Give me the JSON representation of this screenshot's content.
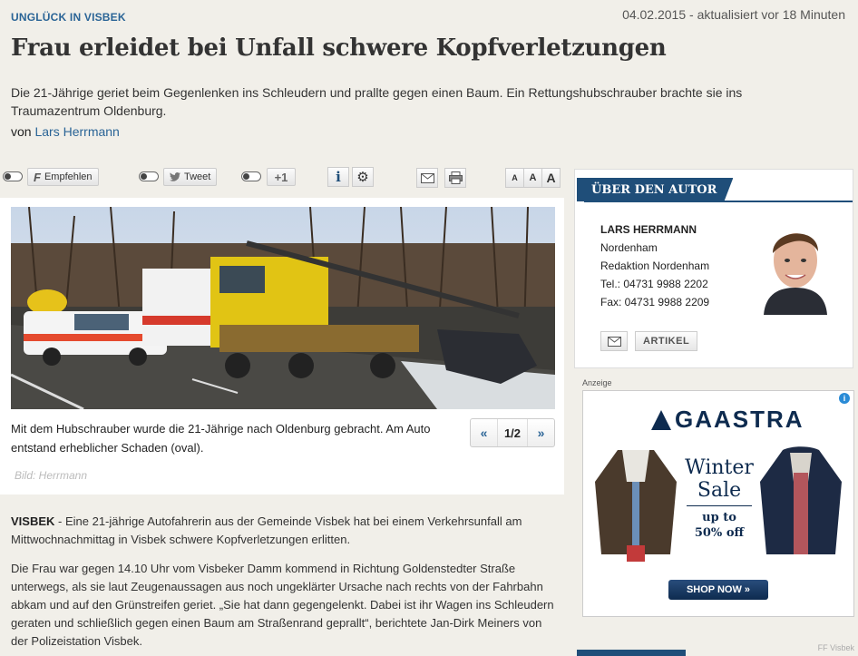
{
  "header": {
    "topline": "UNGLÜCK IN VISBEK",
    "date": "04.02.2015 - aktualisiert vor 18 Minuten",
    "headline": "Frau erleidet bei Unfall schwere Kopfverletzungen",
    "teaser": "Die 21-Jährige geriet beim Gegenlenken ins Schleudern und prallte gegen einen Baum. Ein Rettungshubschrauber brachte sie ins Traumazentrum Oldenburg.",
    "byline_prefix": "von",
    "author_link": "Lars Herrmann"
  },
  "toolbar": {
    "facebook_label": "Empfehlen",
    "facebook_glyph": "F",
    "twitter_label": "Tweet",
    "gplus_label": "+1",
    "info_glyph": "i",
    "settings_glyph": "⚙",
    "mail_glyph": "✉",
    "print_glyph": "🖶",
    "font_small": "A",
    "font_medium": "A",
    "font_large": "A"
  },
  "media": {
    "caption": "Mit dem Hubschrauber wurde die 21-Jährige nach Oldenburg gebracht. Am Auto entstand erheblicher Schaden (oval).",
    "pager_prev": "«",
    "pager_count": "1/2",
    "pager_next": "»",
    "credit": "Bild: Herrmann"
  },
  "article": {
    "dateline": "VISBEK",
    "p1": " - Eine 21-jährige Autofahrerin aus der Gemeinde Visbek hat bei einem Verkehrsunfall am Mittwochnachmittag in Visbek schwere Kopfverletzungen erlitten.",
    "p2": "Die Frau war gegen 14.10 Uhr vom Visbeker Damm kommend in Richtung Goldenstedter Straße unterwegs, als sie laut Zeugenaussagen aus noch ungeklärter Ursache nach rechts von der Fahrbahn abkam und auf den Grünstreifen geriet. „Sie hat dann gegengelenkt. Dabei ist ihr Wagen ins Schleudern geraten und schließlich gegen einen Baum am Straßenrand geprallt“, berichtete Jan-Dirk Meiners von der Polizeistation Visbek."
  },
  "author_box": {
    "title": "ÜBER DEN AUTOR",
    "name": "LARS HERRMANN",
    "location": "Nordenham",
    "department": "Redaktion Nordenham",
    "phone": "Tel.: 04731 9988 2202",
    "fax": "Fax: 04731 9988 2209",
    "articles_label": "ARTIKEL",
    "mail_glyph": "✉"
  },
  "ad": {
    "label": "Anzeige",
    "brand": "GAASTRA",
    "line1": "Winter",
    "line2": "Sale",
    "line3": "up to",
    "line4": "50% off",
    "cta": "SHOP NOW »",
    "info": "i"
  },
  "watermark": "FF Visbek",
  "colors": {
    "link": "#2a6496",
    "ribbon": "#1f4e79",
    "background": "#f1efe9"
  }
}
